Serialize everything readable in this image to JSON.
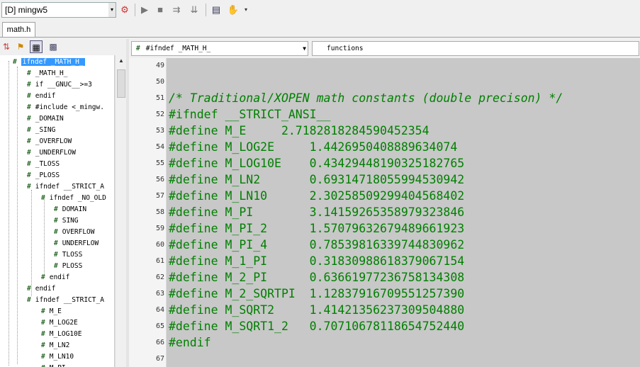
{
  "toolbar": {
    "compiler_combo": "[D] mingw5",
    "combo_arrow": "▾"
  },
  "file_tab": "math.h",
  "outline": {
    "selected": "ifndef _MATH_H_",
    "items": [
      "ifndef _MATH_H_",
      "_MATH_H_",
      "if __GNUC__>=3",
      "endif",
      "#include <_mingw.",
      "_DOMAIN",
      "_SING",
      "_OVERFLOW",
      "_UNDERFLOW",
      "_TLOSS",
      "_PLOSS",
      "ifndef __STRICT_A",
      "ifndef _NO_OLD",
      "DOMAIN",
      "SING",
      "OVERFLOW",
      "UNDERFLOW",
      "TLOSS",
      "PLOSS",
      "endif",
      "endif",
      "ifndef __STRICT_A",
      "M_E",
      "M_LOG2E",
      "M_LOG10E",
      "M_LN2",
      "M_LN10",
      "M_PI"
    ]
  },
  "editor": {
    "scope_selector": "#ifndef _MATH_H_",
    "functions_selector": "functions",
    "lines": [
      {
        "num": "49",
        "text": ""
      },
      {
        "num": "50",
        "text": ""
      },
      {
        "num": "51",
        "text": "/* Traditional/XOPEN math constants (double precison) */",
        "comment": true
      },
      {
        "num": "52",
        "text": "#ifndef __STRICT_ANSI__"
      },
      {
        "num": "53",
        "text": "#define M_E     2.7182818284590452354"
      },
      {
        "num": "54",
        "text": "#define M_LOG2E     1.4426950408889634074"
      },
      {
        "num": "55",
        "text": "#define M_LOG10E    0.43429448190325182765"
      },
      {
        "num": "56",
        "text": "#define M_LN2       0.69314718055994530942"
      },
      {
        "num": "57",
        "text": "#define M_LN10      2.30258509299404568402"
      },
      {
        "num": "58",
        "text": "#define M_PI        3.14159265358979323846"
      },
      {
        "num": "59",
        "text": "#define M_PI_2      1.57079632679489661923"
      },
      {
        "num": "60",
        "text": "#define M_PI_4      0.78539816339744830962"
      },
      {
        "num": "61",
        "text": "#define M_1_PI      0.31830988618379067154"
      },
      {
        "num": "62",
        "text": "#define M_2_PI      0.63661977236758134308"
      },
      {
        "num": "63",
        "text": "#define M_2_SQRTPI  1.12837916709551257390"
      },
      {
        "num": "64",
        "text": "#define M_SQRT2     1.41421356237309504880"
      },
      {
        "num": "65",
        "text": "#define M_SQRT1_2   0.70710678118654752440"
      },
      {
        "num": "66",
        "text": "#endif"
      },
      {
        "num": "67",
        "text": ""
      }
    ]
  },
  "colors": {
    "code_green": "#008000",
    "editor_bg": "#c8c8c8",
    "selection": "#3399ff"
  }
}
